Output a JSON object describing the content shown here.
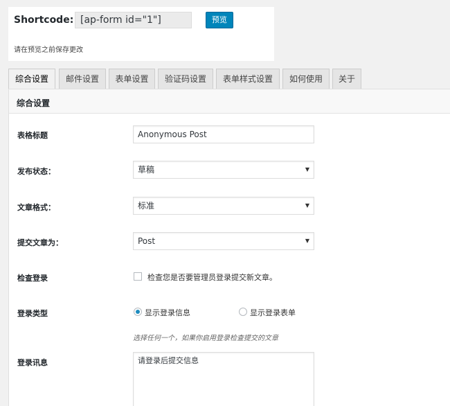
{
  "shortcode": {
    "label": "Shortcode:",
    "value": "[ap-form id=\"1\"]",
    "preview_button": "预览",
    "note": "请在预览之前保存更改"
  },
  "tabs": [
    {
      "label": "综合设置",
      "active": true
    },
    {
      "label": "邮件设置",
      "active": false
    },
    {
      "label": "表单设置",
      "active": false
    },
    {
      "label": "验证码设置",
      "active": false
    },
    {
      "label": "表单样式设置",
      "active": false
    },
    {
      "label": "如何使用",
      "active": false
    },
    {
      "label": "关于",
      "active": false
    }
  ],
  "panel": {
    "title": "综合设置",
    "form_title": {
      "label": "表格标题",
      "value": "Anonymous Post"
    },
    "post_status": {
      "label": "发布状态：",
      "selected": "草稿"
    },
    "post_format": {
      "label": "文章格式：",
      "selected": "标准"
    },
    "submit_as": {
      "label": "提交文章为：",
      "selected": "Post"
    },
    "login_check": {
      "label": "检查登录",
      "checkbox_text": "检查您是否要管理员登录提交新文章。",
      "checked": false
    },
    "login_type": {
      "label": "登录类型",
      "options": [
        {
          "label": "显示登录信息",
          "checked": true
        },
        {
          "label": "显示登录表单",
          "checked": false
        }
      ],
      "hint": "选择任何一个，如果你启用登录检查提交的文章"
    },
    "login_message": {
      "label": "登录讯息",
      "value": "请登录后提交信息"
    }
  },
  "colors": {
    "primary_button": "#0085ba",
    "radio_dot": "#1e8cbe",
    "background": "#f1f1f1"
  },
  "icons": {
    "select_arrow": "▼"
  }
}
